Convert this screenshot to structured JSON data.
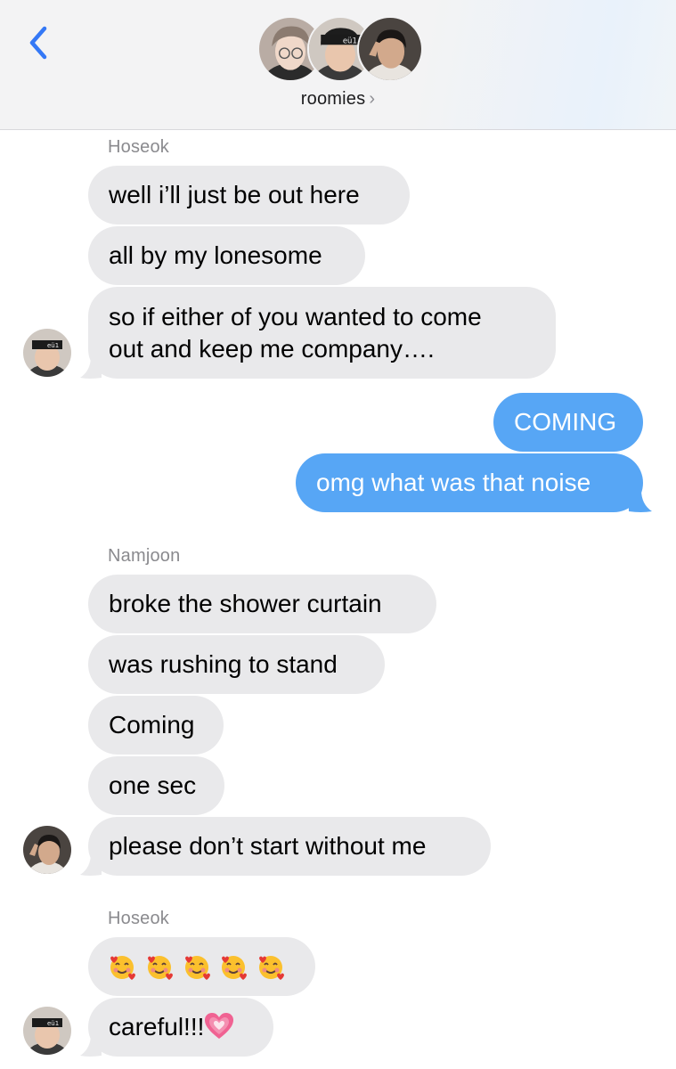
{
  "header": {
    "group_name": "roomies",
    "chevron": "›",
    "back_icon": "chevron-left-icon",
    "accent_color": "#3478f6"
  },
  "groups": [
    {
      "sender": "Hoseok",
      "messages": [
        "well i’ll just be out here",
        "all by my lonesome",
        "so if either of you wanted to come",
        "out and keep me company…."
      ]
    },
    {
      "sender": "me",
      "messages": [
        "COMING",
        "omg what was that noise"
      ]
    },
    {
      "sender": "Namjoon",
      "messages": [
        "broke the shower curtain",
        "was rushing to stand",
        "Coming",
        "one sec",
        "please don’t start without me"
      ]
    },
    {
      "sender": "Hoseok",
      "messages": [
        "smiling-face-with-hearts ×5",
        "careful!!!"
      ],
      "emoji_names": [
        "smiling-face-with-hearts-emoji",
        "growing-heart-emoji"
      ]
    }
  ],
  "colors": {
    "incoming_bubble": "#e9e9eb",
    "outgoing_bubble": "#57a6f5",
    "sender_label": "#8a8a8e"
  }
}
